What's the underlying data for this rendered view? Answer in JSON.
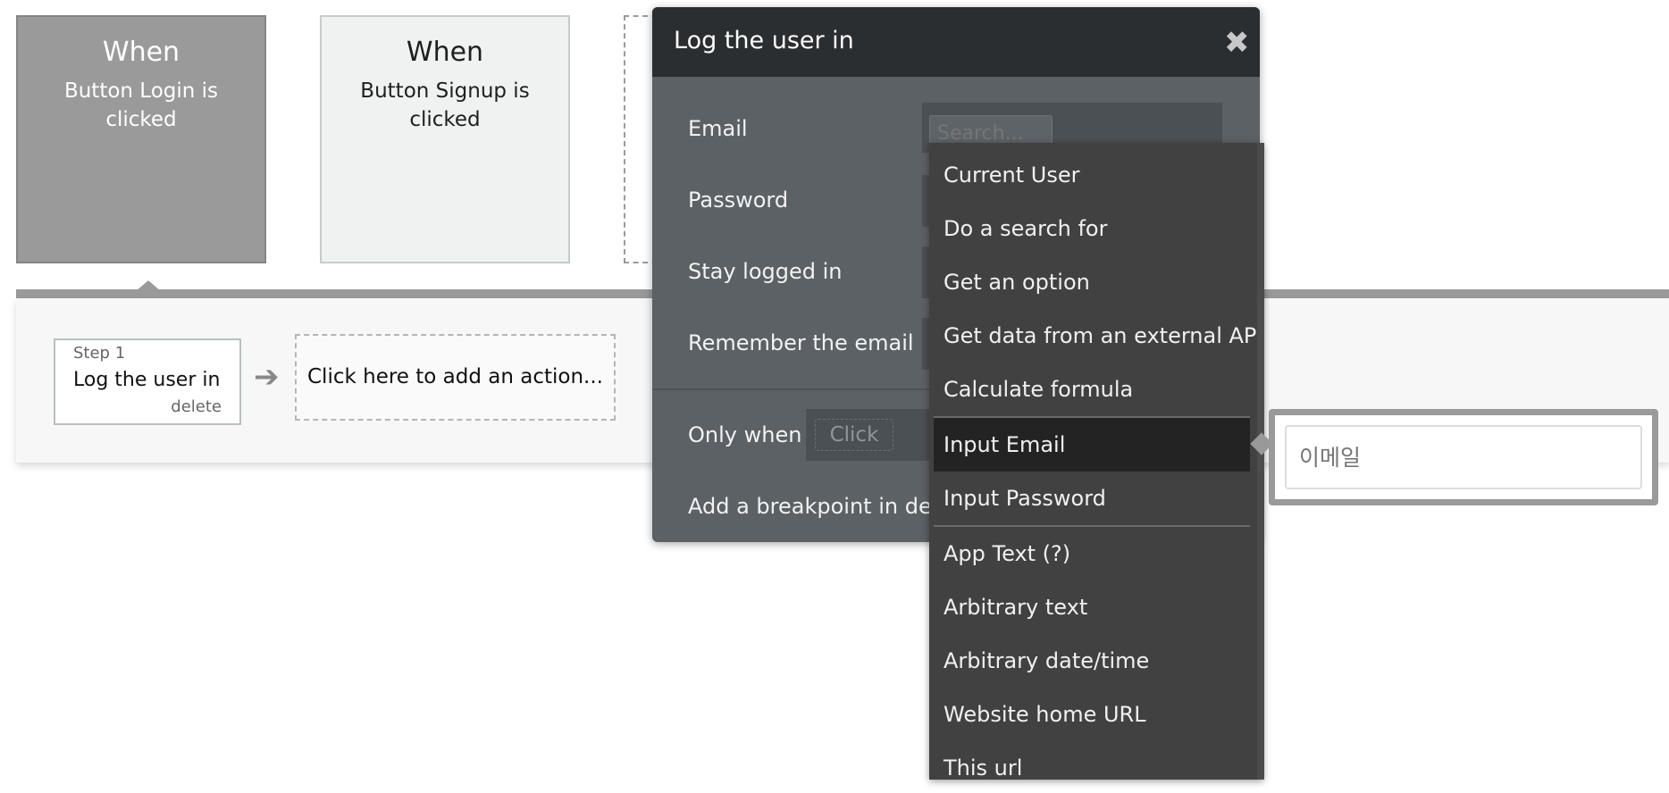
{
  "events": {
    "login": {
      "when": "When",
      "trigger": "Button Login is clicked"
    },
    "signup": {
      "when": "When",
      "trigger": "Button Signup is clicked"
    }
  },
  "workflow": {
    "step": {
      "label": "Step 1",
      "action": "Log the user in",
      "delete": "delete"
    },
    "add_action": "Click here to add an action..."
  },
  "modal": {
    "title": "Log the user in",
    "fields": {
      "email": "Email",
      "password": "Password",
      "stay_logged_in": "Stay logged in",
      "remember_email": "Remember the email",
      "only_when": "Only when",
      "breakpoint": "Add a breakpoint in deb"
    },
    "search_placeholder": "Search...",
    "only_when_chip": "Click"
  },
  "dropdown": {
    "items": [
      "Current User",
      "Do a search for",
      "Get an option",
      "Get data from an external API",
      "Calculate formula",
      "Input Email",
      "Input Password",
      "App Text (?)",
      "Arbitrary text",
      "Arbitrary date/time",
      "Website home URL",
      "This url"
    ],
    "highlighted": "Input Email"
  },
  "tooltip": {
    "placeholder": "이메일"
  },
  "icons": {
    "close": "close-icon",
    "arrow": "arrow-right-icon"
  },
  "colors": {
    "modal_header": "#2a2e31",
    "modal_body": "#5c6165",
    "dropdown": "#414141",
    "dropdown_highlight": "#232323"
  }
}
